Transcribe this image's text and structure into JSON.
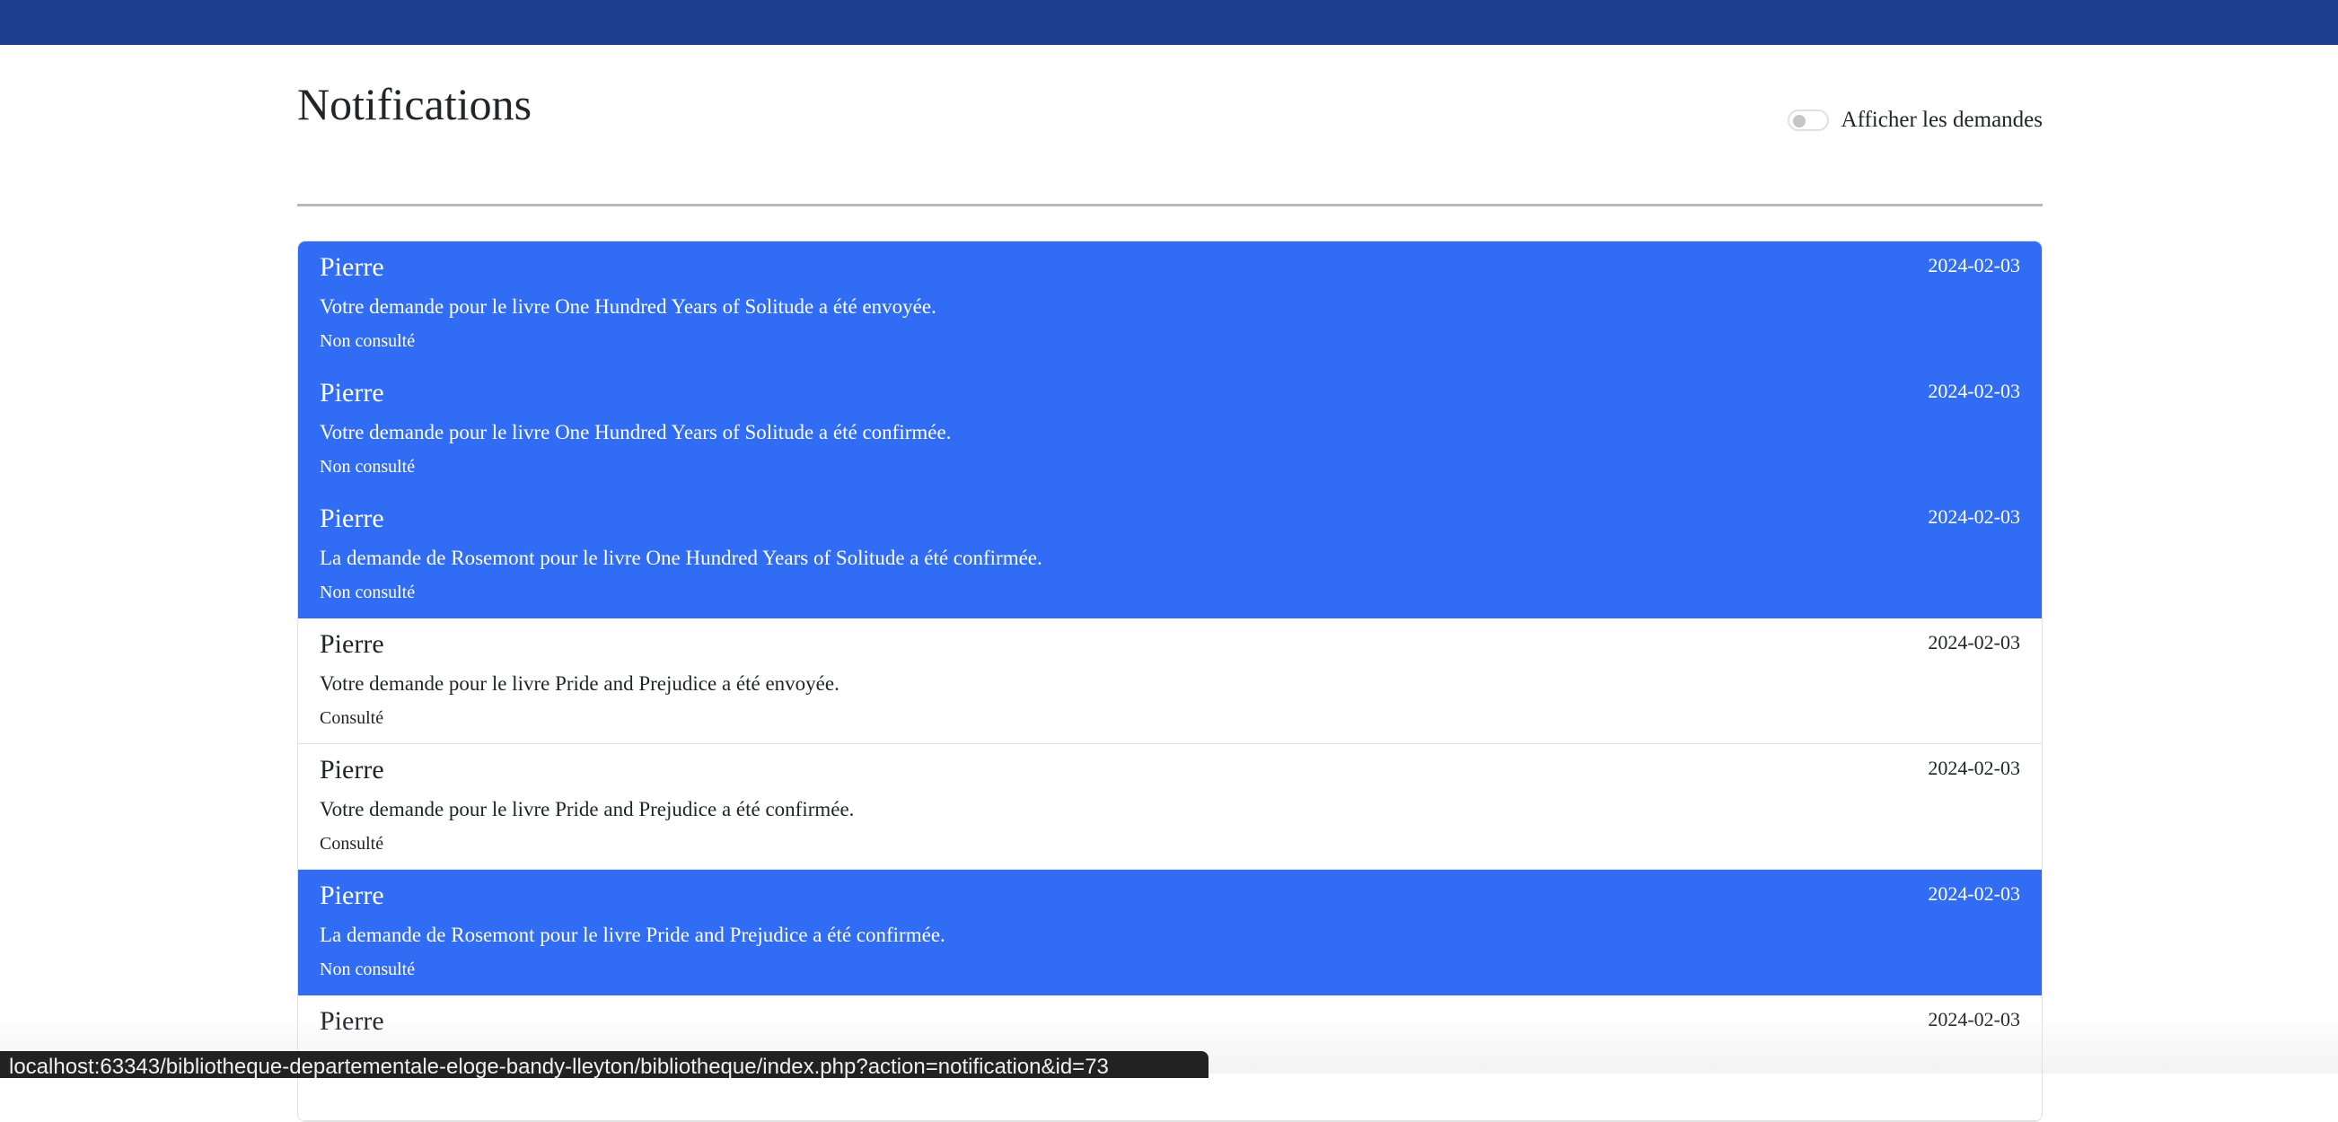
{
  "page": {
    "title": "Notifications",
    "toggle_label": "Afficher les demandes"
  },
  "notifications": [
    {
      "sender": "Pierre",
      "date": "2024-02-03",
      "message": "Votre demande pour le livre One Hundred Years of Solitude a été envoyée.",
      "status": "Non consulté",
      "unread": true
    },
    {
      "sender": "Pierre",
      "date": "2024-02-03",
      "message": "Votre demande pour le livre One Hundred Years of Solitude a été confirmée.",
      "status": "Non consulté",
      "unread": true
    },
    {
      "sender": "Pierre",
      "date": "2024-02-03",
      "message": "La demande de Rosemont pour le livre One Hundred Years of Solitude a été confirmée.",
      "status": "Non consulté",
      "unread": true
    },
    {
      "sender": "Pierre",
      "date": "2024-02-03",
      "message": "Votre demande pour le livre Pride and Prejudice a été envoyée.",
      "status": "Consulté",
      "unread": false
    },
    {
      "sender": "Pierre",
      "date": "2024-02-03",
      "message": "Votre demande pour le livre Pride and Prejudice a été confirmée.",
      "status": "Consulté",
      "unread": false
    },
    {
      "sender": "Pierre",
      "date": "2024-02-03",
      "message": "La demande de Rosemont pour le livre Pride and Prejudice a été confirmée.",
      "status": "Non consulté",
      "unread": true
    },
    {
      "sender": "Pierre",
      "date": "2024-02-03",
      "message": "",
      "status": "",
      "unread": false
    }
  ],
  "statusbar": {
    "url": "localhost:63343/bibliotheque-departementale-eloge-bandy-lleyton/bibliotheque/index.php?action=notification&id=73"
  },
  "colors": {
    "topbar": "#1f3d8f",
    "unread_bg": "#306df4",
    "read_bg": "#ffffff"
  }
}
